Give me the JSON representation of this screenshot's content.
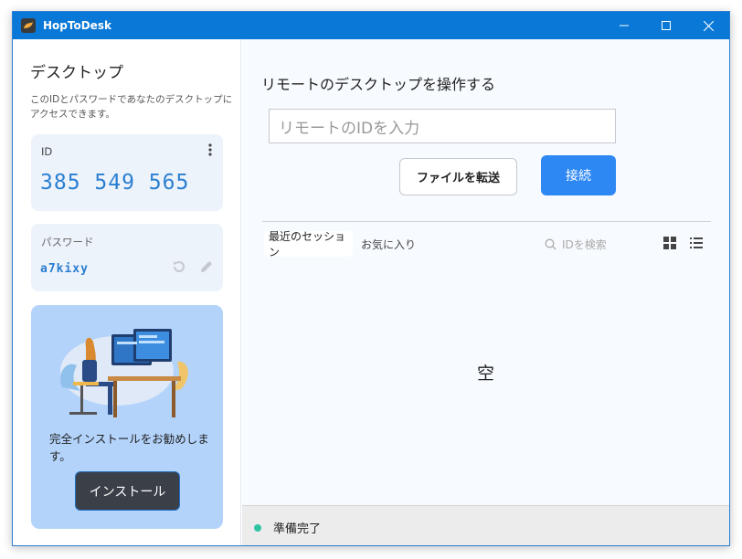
{
  "window": {
    "title": "HopToDesk",
    "controls": [
      "minimize",
      "maximize",
      "close"
    ]
  },
  "left": {
    "title": "デスクトップ",
    "description": "このIDとパスワードであなたのデスクトップにアクセスできます。",
    "id_label": "ID",
    "id_value": "385 549 565",
    "password_label": "パスワード",
    "password_value": "a7kixy",
    "install_text": "完全インストールをお勧めします。",
    "install_button": "インストール"
  },
  "right": {
    "title": "リモートのデスクトップを操作する",
    "remote_id_placeholder": "リモートのIDを入力",
    "transfer_button": "ファイルを転送",
    "connect_button": "接続",
    "tabs": [
      {
        "label": "最近のセッション",
        "active": true
      },
      {
        "label": "お気に入り",
        "active": false
      }
    ],
    "search_placeholder": "IDを検索",
    "empty_text": "空",
    "status_text": "準備完了"
  },
  "colors": {
    "titlebar": "#0a78d7",
    "accent": "#2d88f4",
    "id_text": "#2a7fd1",
    "install_card": "#b3d3fb",
    "status_ok": "#2ec4a3"
  }
}
